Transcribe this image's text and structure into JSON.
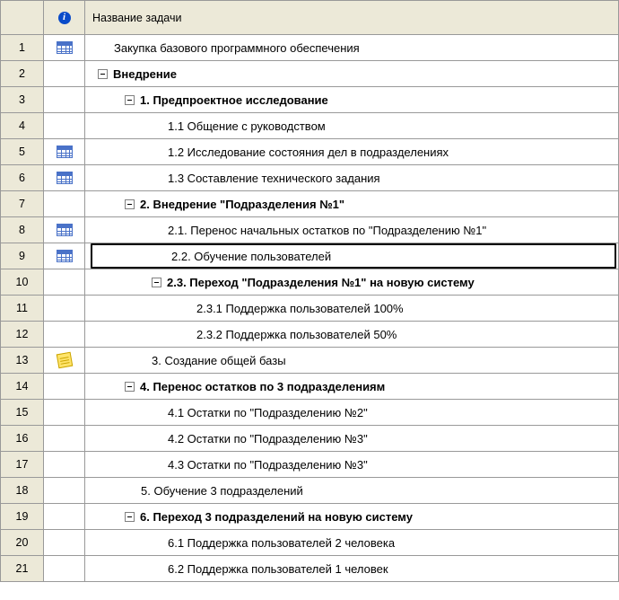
{
  "header": {
    "task_name": "Название задачи"
  },
  "rows": [
    {
      "num": "1",
      "icon": "table",
      "indent": 28,
      "expander": null,
      "bold": false,
      "label": "Закупка базового программного обеспечения",
      "selected": false
    },
    {
      "num": "2",
      "icon": null,
      "indent": 10,
      "expander": "minus",
      "bold": true,
      "label": "Внедрение",
      "selected": false
    },
    {
      "num": "3",
      "icon": null,
      "indent": 40,
      "expander": "minus",
      "bold": true,
      "label": "1. Предпроектное исследование",
      "selected": false
    },
    {
      "num": "4",
      "icon": null,
      "indent": 88,
      "expander": null,
      "bold": false,
      "label": "1.1 Общение с руководством",
      "selected": false
    },
    {
      "num": "5",
      "icon": "table",
      "indent": 88,
      "expander": null,
      "bold": false,
      "label": "1.2 Исследование состояния дел в подразделениях",
      "selected": false
    },
    {
      "num": "6",
      "icon": "table",
      "indent": 88,
      "expander": null,
      "bold": false,
      "label": "1.3 Составление технического задания",
      "selected": false
    },
    {
      "num": "7",
      "icon": null,
      "indent": 40,
      "expander": "minus",
      "bold": true,
      "label": "2. Внедрение \"Подразделения №1\"",
      "selected": false
    },
    {
      "num": "8",
      "icon": "table",
      "indent": 88,
      "expander": null,
      "bold": false,
      "label": "2.1. Перенос начальных остатков по \"Подразделению №1\"",
      "selected": false
    },
    {
      "num": "9",
      "icon": "table",
      "indent": 88,
      "expander": null,
      "bold": false,
      "label": "2.2. Обучение пользователей",
      "selected": true
    },
    {
      "num": "10",
      "icon": null,
      "indent": 70,
      "expander": "minus",
      "bold": true,
      "label": "2.3. Переход \"Подразделения №1\" на новую систему",
      "selected": false
    },
    {
      "num": "11",
      "icon": null,
      "indent": 120,
      "expander": null,
      "bold": false,
      "label": "2.3.1 Поддержка пользователей 100%",
      "selected": false
    },
    {
      "num": "12",
      "icon": null,
      "indent": 120,
      "expander": null,
      "bold": false,
      "label": "2.3.2 Поддержка пользователей 50%",
      "selected": false
    },
    {
      "num": "13",
      "icon": "note",
      "indent": 70,
      "expander": null,
      "bold": false,
      "label": "3. Создание общей базы",
      "selected": false
    },
    {
      "num": "14",
      "icon": null,
      "indent": 40,
      "expander": "minus",
      "bold": true,
      "label": "4. Перенос остатков по 3 подразделениям",
      "selected": false
    },
    {
      "num": "15",
      "icon": null,
      "indent": 88,
      "expander": null,
      "bold": false,
      "label": "4.1 Остатки по \"Подразделению №2\"",
      "selected": false
    },
    {
      "num": "16",
      "icon": null,
      "indent": 88,
      "expander": null,
      "bold": false,
      "label": "4.2 Остатки по \"Подразделению №3\"",
      "selected": false
    },
    {
      "num": "17",
      "icon": null,
      "indent": 88,
      "expander": null,
      "bold": false,
      "label": "4.3 Остатки по \"Подразделению №3\"",
      "selected": false
    },
    {
      "num": "18",
      "icon": null,
      "indent": 58,
      "expander": null,
      "bold": false,
      "label": "5. Обучение 3 подразделений",
      "selected": false
    },
    {
      "num": "19",
      "icon": null,
      "indent": 40,
      "expander": "minus",
      "bold": true,
      "label": "6. Переход 3 подразделений на новую систему",
      "selected": false
    },
    {
      "num": "20",
      "icon": null,
      "indent": 88,
      "expander": null,
      "bold": false,
      "label": "6.1 Поддержка пользователей 2 человека",
      "selected": false
    },
    {
      "num": "21",
      "icon": null,
      "indent": 88,
      "expander": null,
      "bold": false,
      "label": "6.2 Поддержка пользователей 1 человек",
      "selected": false
    }
  ]
}
